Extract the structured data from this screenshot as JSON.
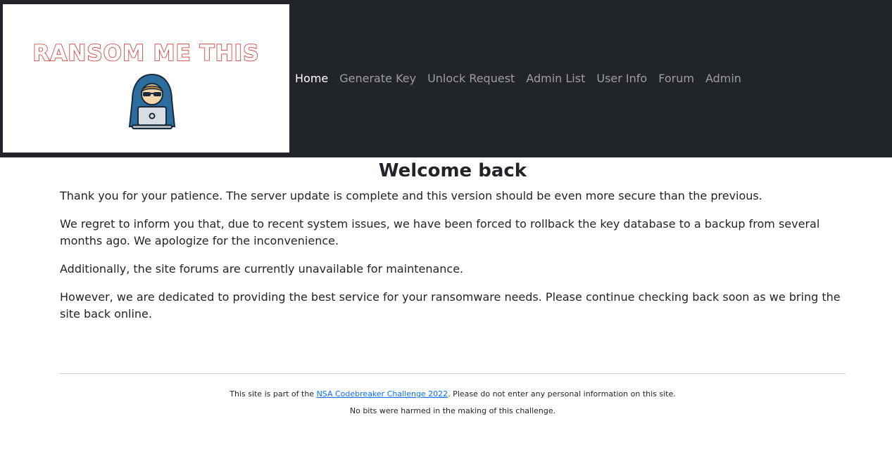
{
  "logo": {
    "text": "RANSOM ME THIS",
    "icon": "hacker-laptop-icon",
    "text_color": "#d12c2c"
  },
  "nav": {
    "background": "#212529",
    "items": [
      {
        "label": "Home",
        "active": true
      },
      {
        "label": "Generate Key"
      },
      {
        "label": "Unlock Request"
      },
      {
        "label": "Admin List"
      },
      {
        "label": "User Info"
      },
      {
        "label": "Forum"
      },
      {
        "label": "Admin"
      }
    ]
  },
  "main": {
    "title": "Welcome back",
    "paragraphs": [
      "Thank you for your patience. The server update is complete and this version should be even more secure than the previous.",
      "We regret to inform you that, due to recent system issues, we have been forced to rollback the key database to a backup from several months ago. We apologize for the inconvenience.",
      "Additionally, the site forums are currently unavailable for maintenance.",
      "However, we are dedicated to providing the best service for your ransomware needs. Please continue checking back soon as we bring the site back online."
    ]
  },
  "footer": {
    "line1_prefix": "This site is part of the ",
    "line1_link": "NSA Codebreaker Challenge 2022",
    "line1_suffix": ". Please do not enter any personal information on this site.",
    "line2": "No bits were harmed in the making of this challenge.",
    "link_color": "#0d6efd"
  }
}
